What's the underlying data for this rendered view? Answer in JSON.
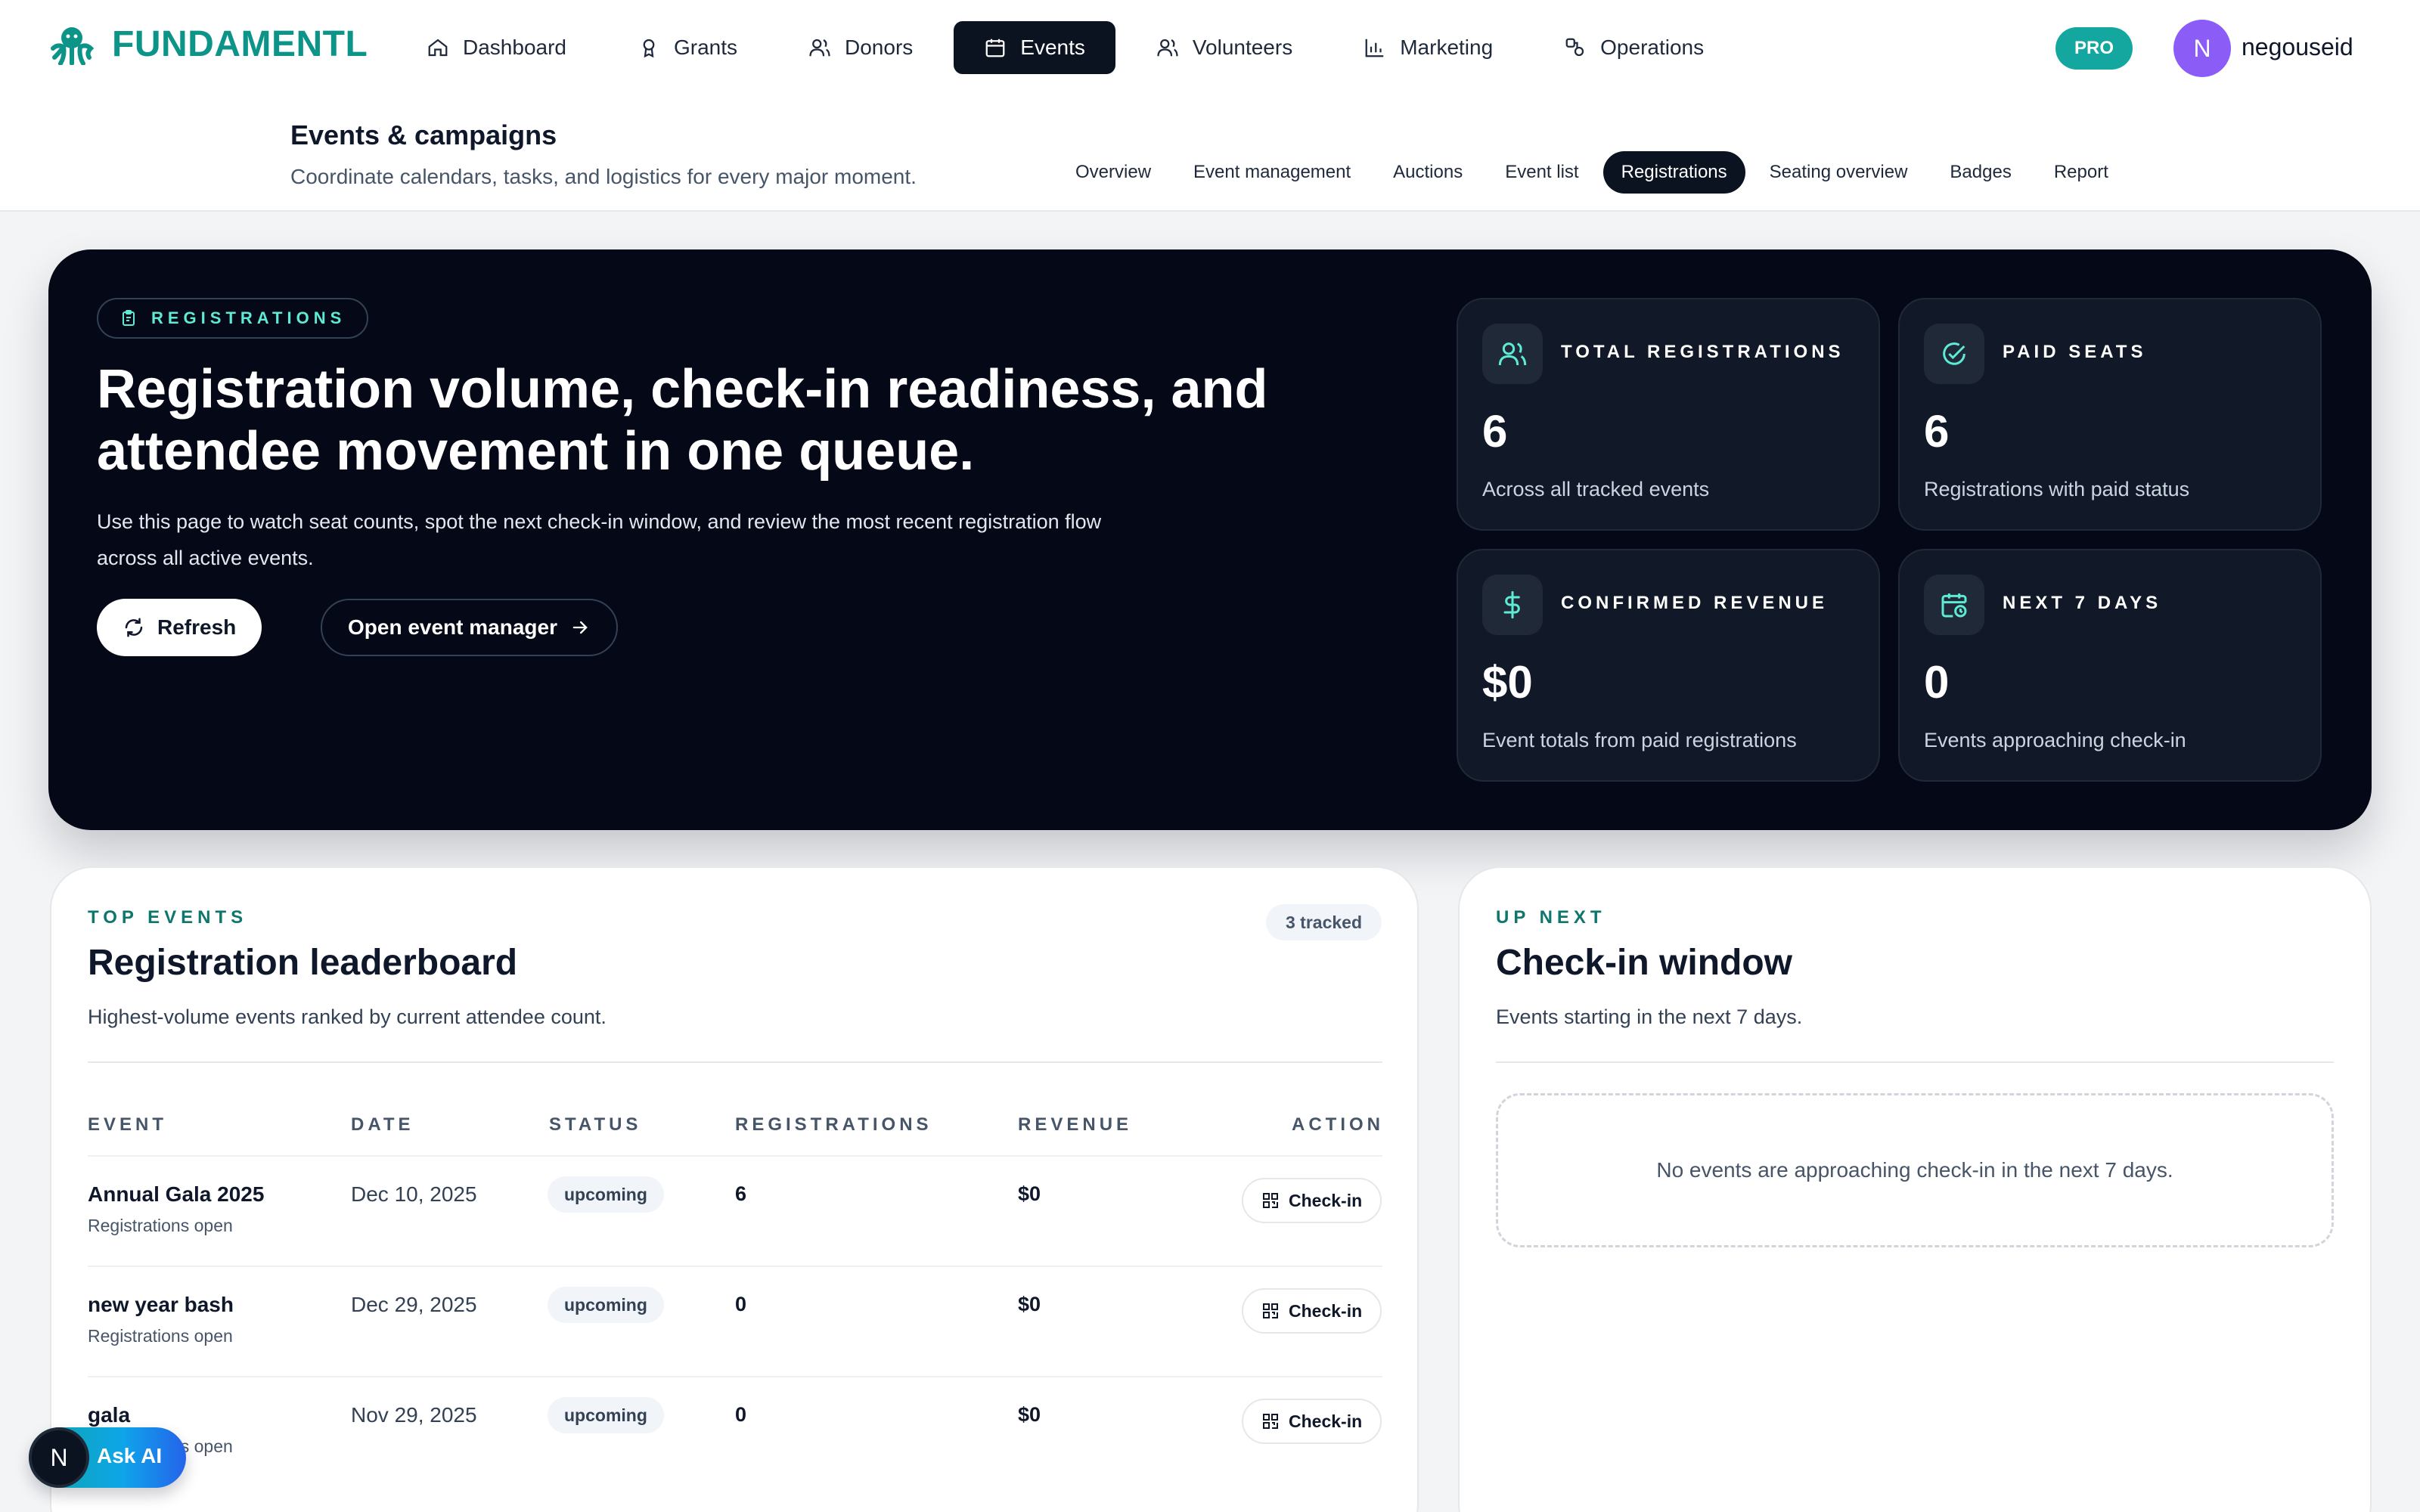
{
  "brand": {
    "name": "FUNDAMENTL",
    "color": "#0d9488",
    "icon": "octopus-logo-icon"
  },
  "nav": {
    "items": [
      {
        "label": "Dashboard",
        "icon": "home-icon"
      },
      {
        "label": "Grants",
        "icon": "award-icon"
      },
      {
        "label": "Donors",
        "icon": "users-icon"
      },
      {
        "label": "Events",
        "icon": "calendar-icon",
        "active": true
      },
      {
        "label": "Volunteers",
        "icon": "users-icon"
      },
      {
        "label": "Marketing",
        "icon": "bar-chart-icon"
      },
      {
        "label": "Operations",
        "icon": "operations-icon"
      }
    ],
    "plan_badge": "PRO",
    "user_initial": "N",
    "username": "negouseid"
  },
  "page": {
    "title": "Events & campaigns",
    "subtitle": "Coordinate calendars, tasks, and logistics for every major moment.",
    "tabs": [
      "Overview",
      "Event management",
      "Auctions",
      "Event list",
      "Registrations",
      "Seating overview",
      "Badges",
      "Report"
    ],
    "active_tab": "Registrations"
  },
  "hero": {
    "pill": "REGISTRATIONS",
    "title": "Registration volume, check-in readiness, and attendee movement in one queue.",
    "description": "Use this page to watch seat counts, spot the next check-in window, and review the most recent registration flow across all active events.",
    "refresh_label": "Refresh",
    "manager_label": "Open event manager",
    "stats": [
      {
        "label": "TOTAL REGISTRATIONS",
        "value": "6",
        "sub": "Across all tracked events",
        "icon": "users-icon"
      },
      {
        "label": "PAID SEATS",
        "value": "6",
        "sub": "Registrations with paid status",
        "icon": "check-circle-icon"
      },
      {
        "label": "CONFIRMED REVENUE",
        "value": "$0",
        "sub": "Event totals from paid registrations",
        "icon": "dollar-icon"
      },
      {
        "label": "NEXT 7 DAYS",
        "value": "0",
        "sub": "Events approaching check-in",
        "icon": "calendar-clock-icon"
      }
    ]
  },
  "leaderboard": {
    "eyebrow": "TOP EVENTS",
    "title": "Registration leaderboard",
    "subtitle": "Highest-volume events ranked by current attendee count.",
    "tracked": "3 tracked",
    "columns": [
      "EVENT",
      "DATE",
      "STATUS",
      "REGISTRATIONS",
      "REVENUE",
      "ACTION"
    ],
    "rows": [
      {
        "name": "Annual Gala 2025",
        "note": "Registrations open",
        "date": "Dec 10, 2025",
        "status": "upcoming",
        "registrations": "6",
        "revenue": "$0",
        "action": "Check-in"
      },
      {
        "name": "new year bash",
        "note": "Registrations open",
        "date": "Dec 29, 2025",
        "status": "upcoming",
        "registrations": "0",
        "revenue": "$0",
        "action": "Check-in"
      },
      {
        "name": "gala",
        "note": "Registrations open",
        "date": "Nov 29, 2025",
        "status": "upcoming",
        "registrations": "0",
        "revenue": "$0",
        "action": "Check-in"
      }
    ]
  },
  "checkin": {
    "eyebrow": "UP NEXT",
    "title": "Check-in window",
    "subtitle": "Events starting in the next 7 days.",
    "empty": "No events are approaching check-in in the next 7 days."
  },
  "ask_ai": {
    "initial": "N",
    "label": "Ask AI"
  },
  "colors": {
    "accent": "#0d9488",
    "hero_bg": "#050816",
    "pro": "#14a7a0",
    "avatar": "#8b5cf6"
  }
}
